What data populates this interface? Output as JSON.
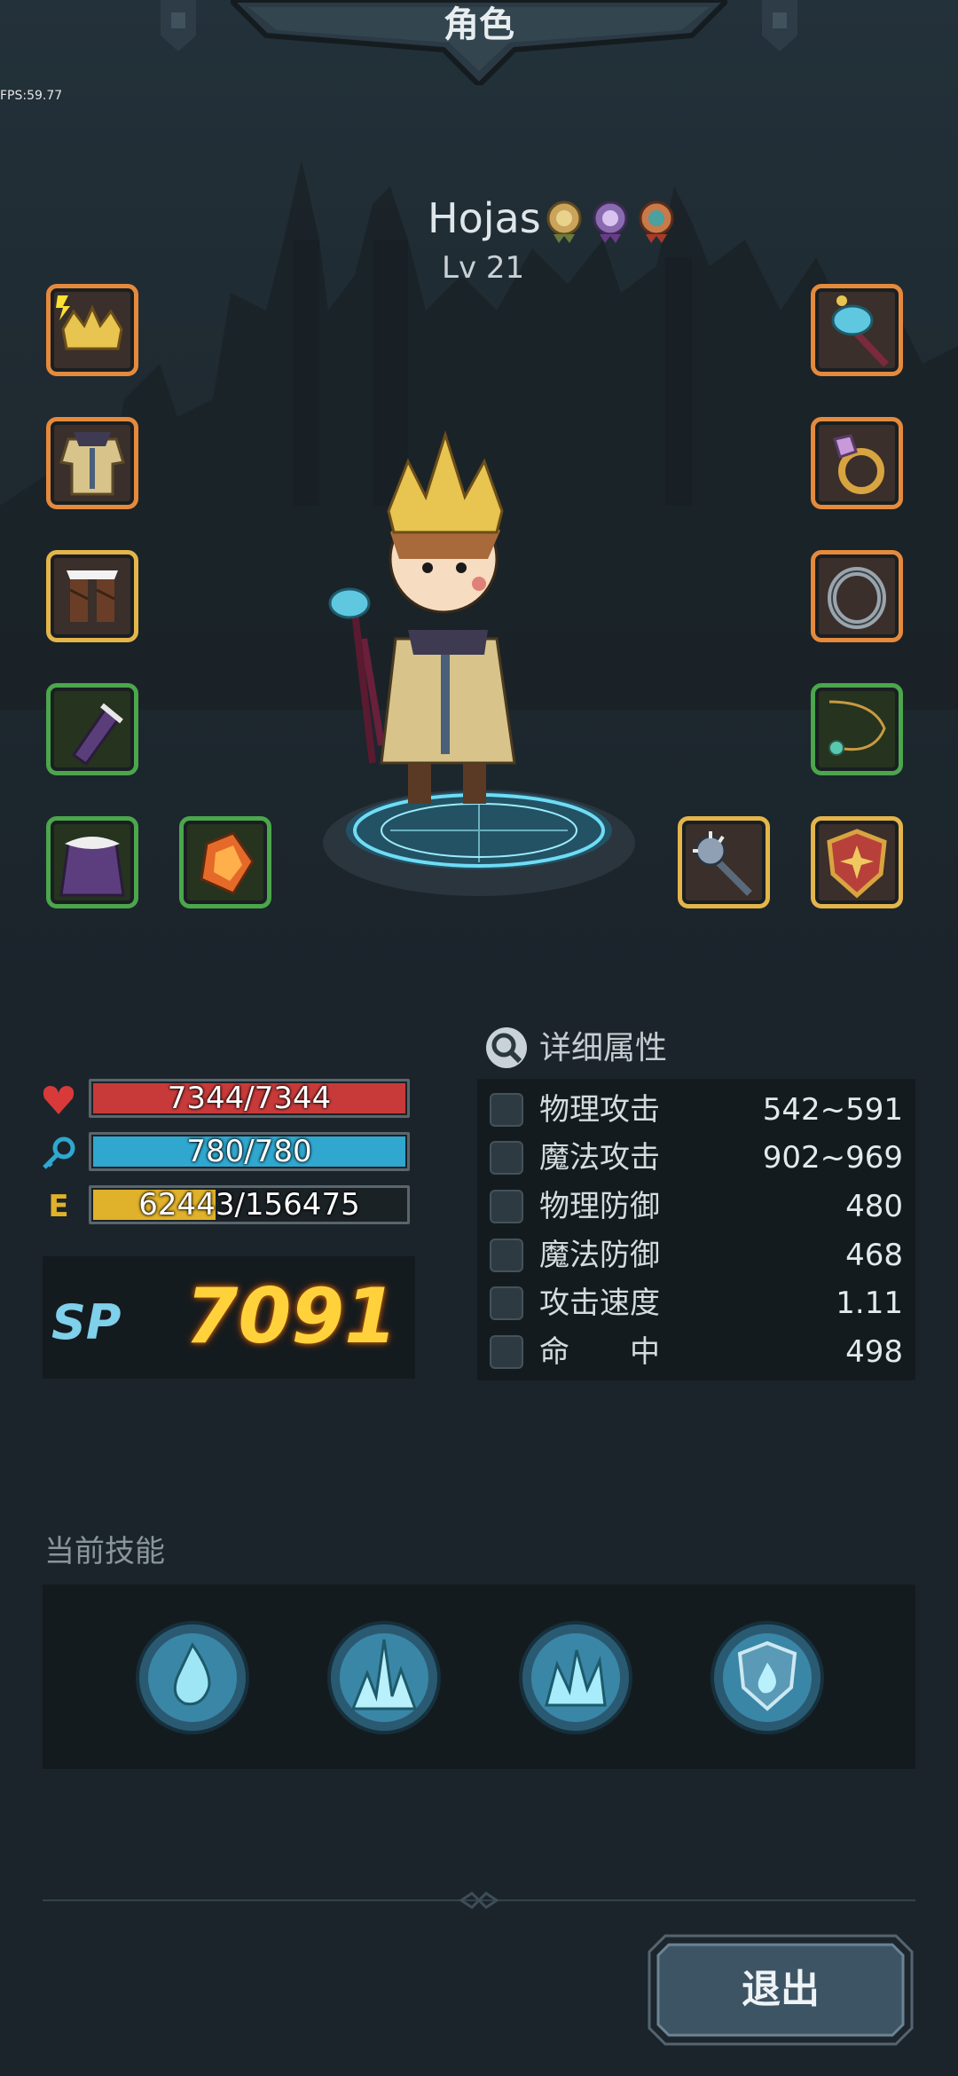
{
  "header": {
    "title": "角色"
  },
  "debug": {
    "fps": "FPS:59.77"
  },
  "hero": {
    "name": "Hojas",
    "level": "Lv 21",
    "medals": [
      "bronze-medal-icon",
      "purple-medal-icon",
      "red-medal-icon"
    ]
  },
  "equipment": {
    "left": [
      "crown-helmet",
      "robe-armor",
      "fur-boots",
      "gauntlet",
      "cape"
    ],
    "left_extra": "fire-gem",
    "right": [
      "bird-staff",
      "gem-ring",
      "iron-ring",
      "pendant-necklace",
      "shield"
    ],
    "right_extra": "mace"
  },
  "stats": {
    "hp": {
      "text": "7344/7344",
      "fill": 1.0,
      "color": "#c83a3a"
    },
    "mp": {
      "text": "780/780",
      "fill": 1.0,
      "color": "#2fa7cf"
    },
    "exp": {
      "text": "62443/156475",
      "fill": 0.4,
      "color": "#e0b12a",
      "label": "E"
    }
  },
  "sp": {
    "label": "SP",
    "value": "7091"
  },
  "detail": {
    "title": "详细属性",
    "attributes": [
      {
        "name": "物理攻击",
        "value": "542~591"
      },
      {
        "name": "魔法攻击",
        "value": "902~969"
      },
      {
        "name": "物理防御",
        "value": "480"
      },
      {
        "name": "魔法防御",
        "value": "468"
      },
      {
        "name": "攻击速度",
        "value": "1.11"
      },
      {
        "name": "命　　中",
        "value": "498"
      }
    ]
  },
  "skills": {
    "label": "当前技能",
    "items": [
      "water-drop-skill-icon",
      "ice-spike-skill-icon",
      "ice-crystal-skill-icon",
      "water-shield-skill-icon"
    ]
  },
  "exit": {
    "label": "退出"
  }
}
